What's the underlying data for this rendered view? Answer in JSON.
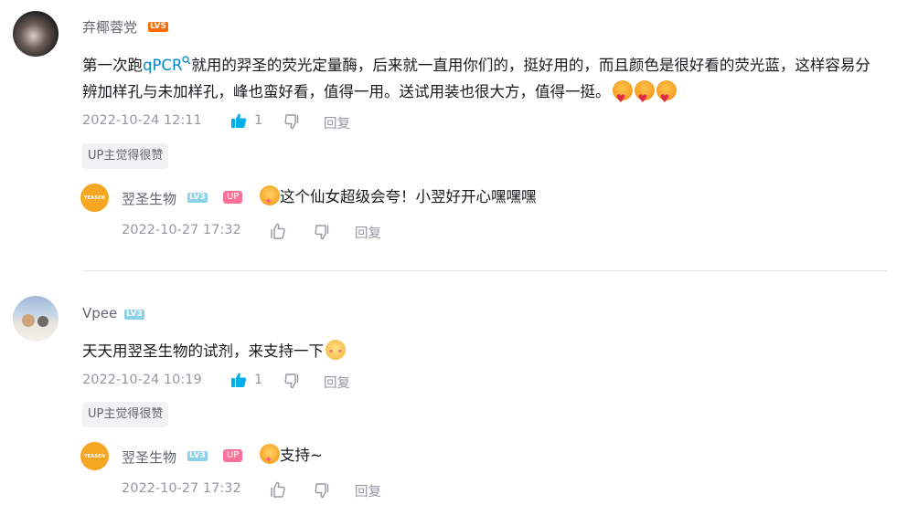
{
  "comments": [
    {
      "username": "弃椰蓉党",
      "level": "LV5",
      "level_color": "#ff6c00",
      "content_before": "第一次跑",
      "keyword": "qPCR",
      "content_after": "就用的羿圣的荧光定量酶，后来就一直用你们的，挺好用的，而且颜色是很好看的荧光蓝，这样容易分辨加样孔与未加样孔，峰也蛮好看，值得一用。送试用装也很大方，值得一挺。",
      "emoji_names": [
        "love-heart-face-emoji",
        "love-heart-face-emoji",
        "love-heart-face-emoji"
      ],
      "time": "2022-10-24 12:11",
      "likes": "1",
      "reply_label": "回复",
      "up_tag": "UP主觉得很赞",
      "reply": {
        "username": "翌圣生物",
        "logo_text": "YEASEN",
        "level": "LV3",
        "level_color": "#8bd1e8",
        "up_label": "UP",
        "content": "这个仙女超级会夸！小翌好开心嘿嘿嘿",
        "time": "2022-10-27 17:32",
        "reply_label": "回复"
      }
    },
    {
      "username": "Vpee",
      "level": "LV3",
      "level_color": "#8bd1e8",
      "content": "天天用翌圣生物的试剂，来支持一下",
      "time": "2022-10-24 10:19",
      "likes": "1",
      "reply_label": "回复",
      "up_tag": "UP主觉得很赞",
      "reply": {
        "username": "翌圣生物",
        "logo_text": "YEASEN",
        "level": "LV3",
        "level_color": "#8bd1e8",
        "up_label": "UP",
        "content": "支持~",
        "time": "2022-10-27 17:32",
        "reply_label": "回复"
      }
    }
  ],
  "colors": {
    "accent_blue": "#008ac5",
    "like_active": "#00aeec",
    "meta_gray": "#9499a0"
  }
}
